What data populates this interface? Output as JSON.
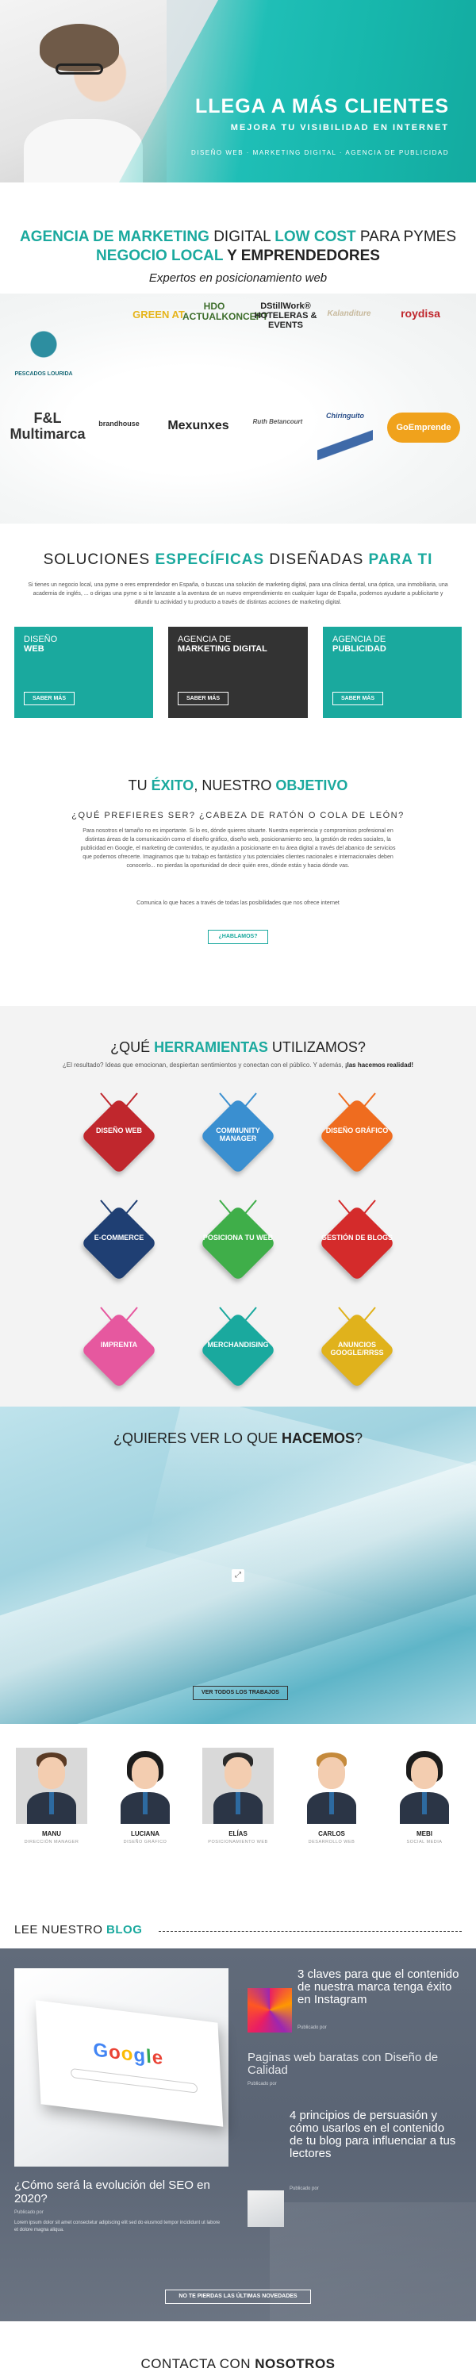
{
  "hero": {
    "title": "LLEGA A MÁS CLIENTES",
    "subtitle": "MEJORA TU VISIBILIDAD EN INTERNET",
    "tagline": "DISEÑO WEB · MARKETING DIGITAL · AGENCIA DE PUBLICIDAD"
  },
  "intro": {
    "h1_a": "AGENCIA DE MARKETING ",
    "h1_b": "DIGITAL ",
    "h1_c": "LOW COST ",
    "h1_d": " PARA PYMES",
    "h2_a": "NEGOCIO LOCAL",
    "h2_b": " Y EMPRENDEDORES",
    "expert": "Expertos en posicionamiento web"
  },
  "logos": [
    {
      "text": "HDO\nACTUALKONCEPT"
    },
    {
      "text": "DStillWork®\nHOTELERAS & EVENTS"
    },
    {
      "text": "Kalanditure"
    },
    {
      "text": "roydisa"
    },
    {
      "text": "GREEN AT"
    },
    {
      "text": "PESCADOS LOURIDA"
    },
    {
      "text": "F&L\nMultimarca"
    },
    {
      "text": "brandhouse"
    },
    {
      "text": "Mexunxes"
    },
    {
      "text": "Ruth Betancourt"
    },
    {
      "text": "Chiringuito"
    },
    {
      "text": "GoEmprende"
    }
  ],
  "soluciones": {
    "title_a": "SOLUCIONES ",
    "title_b": "ESPECÍFICAS",
    "title_c": " DISEÑADAS ",
    "title_d": " PARA TI",
    "text": "Si tienes un negocio local, una pyme o eres emprendedor en España, o buscas una solución de marketing digital, para una clínica dental, una óptica, una inmobiliaria, una academia de inglés, ... o dirigas una pyme o si te lanzaste a la aventura de un nuevo emprendimiento en cualquier lugar de España, podemos ayudarte a publicitarte y difundir tu actividad y tu producto a través de distintas acciones de marketing digital.",
    "cards": [
      {
        "line1": "DISEÑO",
        "line2": "WEB",
        "btn": "SABER MÁS"
      },
      {
        "line1": "AGENCIA DE",
        "line2": "MARKETING DIGITAL",
        "btn": "SABER MÁS"
      },
      {
        "line1": "AGENCIA DE",
        "line2": "PUBLICIDAD",
        "btn": "SABER MÁS"
      }
    ]
  },
  "exito": {
    "title_a": "TU ",
    "title_b": "ÉXITO",
    "title_c": ", NUESTRO ",
    "title_d": "OBJETIVO",
    "question": "¿QUÉ PREFIERES SER? ¿CABEZA DE RATÓN O COLA DE LEÓN?",
    "paragraph": "Para nosotros el tamaño no es importante. Si lo es, dónde quieres situarte. Nuestra experiencia y compromisos profesional en distintas áreas de la comunicación como el diseño gráfico, diseño web, posicionamiento seo, la gestión de redes sociales, la publicidad en Google, el marketing de contenidos, te ayudarán a posicionarte en tu área digital a través del abanico de servicios que podemos ofrecerte. Imaginamos que tu trabajo es fantástico y tus potenciales clientes nacionales e internacionales deben conocerlo... no pierdas la oportunidad de decir quién eres, dónde estás y hacia dónde vas.",
    "paragraph2": "Comunica lo que haces a través de todas las posibilidades que nos ofrece internet",
    "btn": "¿HABLAMOS?"
  },
  "tools": {
    "title_a": "¿QUÉ ",
    "title_b": "HERRAMIENTAS",
    "title_c": " UTILIZAMOS?",
    "sub_a": "¿El resultado? Ideas que emocionan, despiertan sentimientos y conectan con el público. Y además, ",
    "sub_b": "¡las hacemos realidad!",
    "items": [
      {
        "label": "DISEÑO WEB",
        "color": "#c0272d"
      },
      {
        "label": "COMMUNITY MANAGER",
        "color": "#3a8fd0"
      },
      {
        "label": "DISEÑO GRÁFICO",
        "color": "#ef6c1f"
      },
      {
        "label": "E-COMMERCE",
        "color": "#1f3f73"
      },
      {
        "label": "POSICIONA TU WEB",
        "color": "#3fae49"
      },
      {
        "label": "GESTIÓN DE BLOGS",
        "color": "#d42b2b"
      },
      {
        "label": "IMPRENTA",
        "color": "#e6589f"
      },
      {
        "label": "MERCHANDISING",
        "color": "#1aa99e"
      },
      {
        "label": "ANUNCIOS GOOGLE/RRSS",
        "color": "#e0b21c"
      }
    ]
  },
  "works": {
    "title_a": "¿QUIERES VER LO QUE ",
    "title_b": "HACEMOS",
    "title_c": "?",
    "btn": "VER TODOS LOS TRABAJOS"
  },
  "team": [
    {
      "name": "MANU",
      "role": "DIRECCIÓN MANAGER",
      "hair": "#5a3a24"
    },
    {
      "name": "LUCIANA",
      "role": "DISEÑO GRÁFICO",
      "hair": "#1b1b1b"
    },
    {
      "name": "ELÍAS",
      "role": "POSICIONAMIENTO WEB",
      "hair": "#2a2a2a"
    },
    {
      "name": "CARLOS",
      "role": "DESARROLLO WEB",
      "hair": "#c58a3c"
    },
    {
      "name": "MEBI",
      "role": "SOCIAL MEDIA",
      "hair": "#1b1b1b"
    }
  ],
  "blog": {
    "title_a": "LEE NUESTRO ",
    "title_b": "BLOG",
    "main": {
      "title": "¿Cómo será la evolución del SEO en 2020?",
      "meta": "Publicado por",
      "excerpt": "Lorem ipsum dolor sit amet consectetur adipiscing elit sed do eiusmod tempor incididunt ut labore et dolore magna aliqua."
    },
    "side": [
      {
        "title": "3 claves para que el contenido de nuestra marca tenga éxito en Instagram",
        "meta": "Publicado por"
      },
      {
        "title": "Paginas web baratas con Diseño de Calidad",
        "meta": "Publicado por"
      },
      {
        "title": "4 principios de persuasión y cómo usarlos en el contenido de tu blog para influenciar a tus lectores",
        "meta": "Publicado por"
      }
    ],
    "btn": "NO TE PIERDAS LAS ÚLTIMAS NOVEDADES"
  },
  "contact": {
    "title_a": "CONTACTA CON ",
    "title_b": "NOSOTROS"
  },
  "colors": {
    "teal": "#1aa99e",
    "dark": "#333333"
  }
}
